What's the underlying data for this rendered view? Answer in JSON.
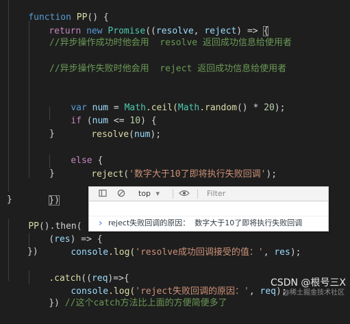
{
  "editor": {
    "code": {
      "l1_function": "function",
      "l1_name": "PP",
      "l1_rest": "() {",
      "l2_return": "return",
      "l2_new": "new",
      "l2_promise": "Promise",
      "l2_open": "((",
      "l2_resolve": "resolve",
      "l2_comma": ", ",
      "l2_reject": "reject",
      "l2_arrow": ") => ",
      "l2_brace": "{",
      "l4_comment": "//异步操作成功时他会用  resolve 返回成功信息给使用者",
      "l6_comment": "//异步操作失败时他会用  reject 返回成功信息给使用者",
      "l8_var": "var",
      "l8_num": "num",
      "l8_eq": " = ",
      "l8_math1": "Math",
      "l8_ceil": ".ceil(",
      "l8_math2": "Math",
      "l8_random": ".random",
      "l8_mul": "() * ",
      "l8_20": "20",
      "l8_end": ");",
      "l9_if": "if",
      "l9_open": " (",
      "l9_num": "num",
      "l9_le": " <= ",
      "l9_10": "10",
      "l9_end": ") {",
      "l10_resolve": "resolve",
      "l10_open": "(",
      "l10_num": "num",
      "l10_end": ");",
      "l11": "}",
      "l12_else": "else",
      "l12_end": " {",
      "l13_reject": "reject",
      "l13_open": "(",
      "l13_str": "'数字大于10了即将执行失败回调'",
      "l13_end": ");",
      "l14": "}",
      "l15_paren": ")",
      "l15_close": "})",
      "l16": "}",
      "l17_pp": "PP",
      "l17_then": "().then(",
      "l18_open": "(",
      "l18_res": "res",
      "l18_arrow": ") => {",
      "l19_console": "console",
      "l19_log": ".log(",
      "l19_str": "'resolve成功回调接受的值：'",
      "l19_comma": ", ",
      "l19_res": "res",
      "l19_end": ");",
      "l20": "})",
      "l21_catch": ".catch",
      "l21_open": "((",
      "l21_req": "req",
      "l21_arrow": ")=>{",
      "l22_console": "console",
      "l22_log": ".log(",
      "l22_str": "'reject失败回调的原因：'",
      "l22_comma": ", ",
      "l22_req": "req",
      "l22_end": ");",
      "l23_close": "}) ",
      "l23_comment": "//这个catch方法比上面的方便简便多了"
    }
  },
  "console": {
    "toolbar": {
      "context": "top",
      "context_arrow": "▾",
      "filter_placeholder": "Filter",
      "clear_icon": "⃠",
      "eye_icon": "👁"
    },
    "message": "reject失败回调的原因：  数字大于10了即将执行失败回调",
    "prompt_caret": "›"
  },
  "watermark": {
    "text": "CSDN @根号三X",
    "sub": "@稀土掘金技术社区"
  },
  "colors": {
    "background": "#1e1e1e",
    "keyword": "#569cd6",
    "control": "#c586c0",
    "function": "#dcdcaa",
    "class": "#4ec9b0",
    "variable": "#9cdcfe",
    "number": "#b5cea8",
    "string": "#ce9178",
    "comment": "#6a9955"
  }
}
